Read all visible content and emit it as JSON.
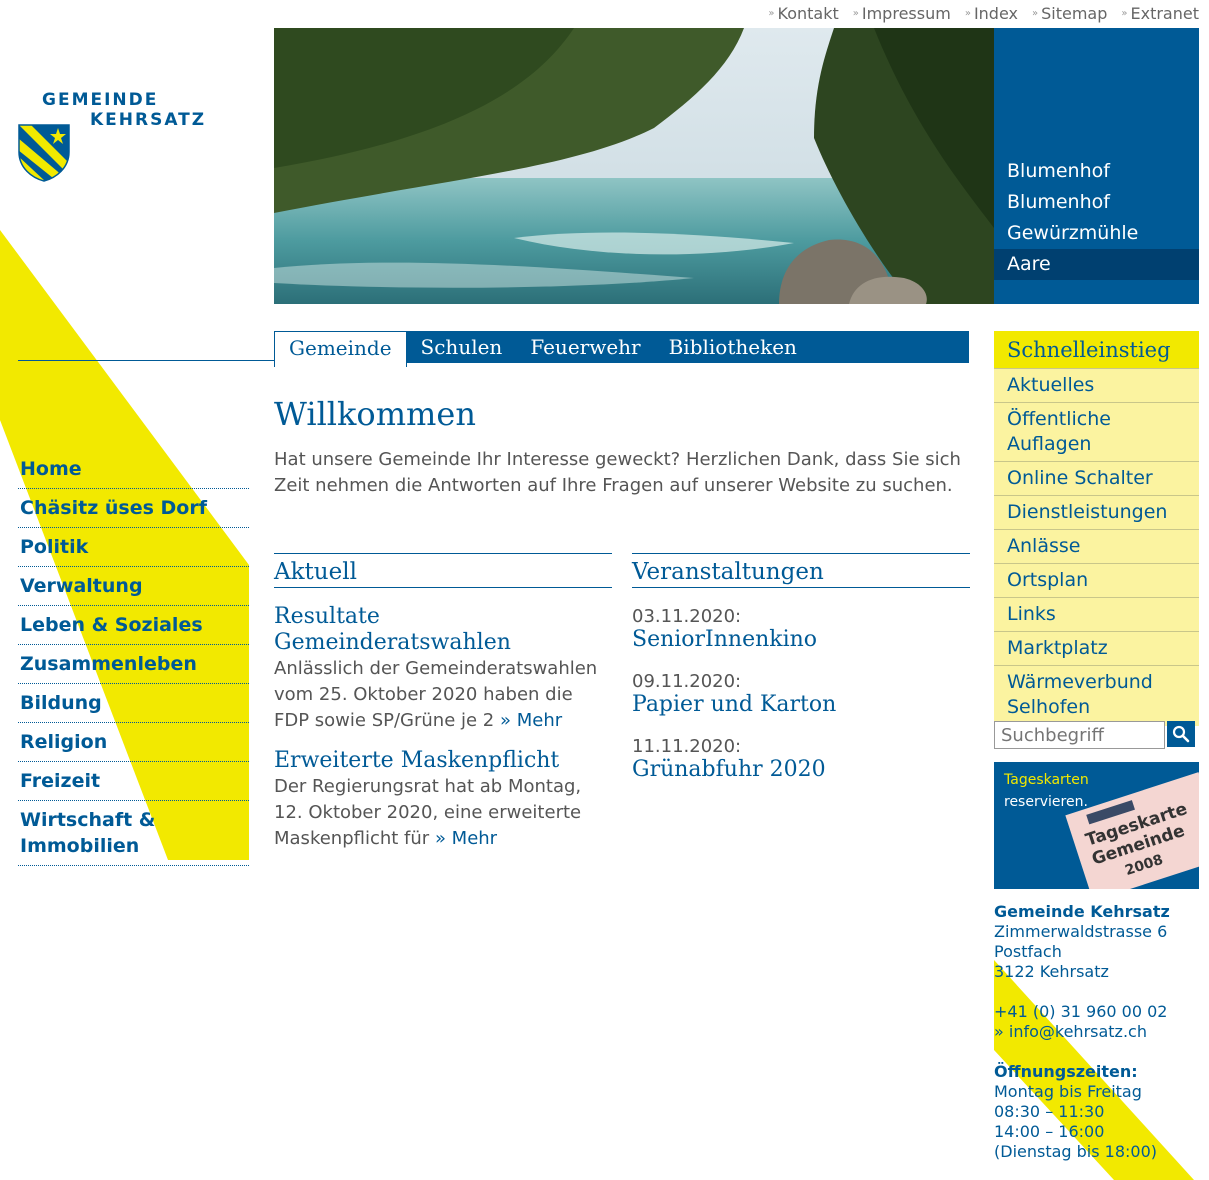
{
  "toplinks": [
    "Kontakt",
    "Impressum",
    "Index",
    "Sitemap",
    "Extranet"
  ],
  "logo": {
    "line1": "GEMEINDE",
    "line2": "KEHRSATZ"
  },
  "colors": {
    "brand_blue": "#005a96",
    "yellow": "#f2e900",
    "light_yellow": "#fbf3a0"
  },
  "hero_panel": {
    "items": [
      "Blumenhof",
      "Blumenhof",
      "Gewürzmühle",
      "Aare"
    ],
    "active": "Aare"
  },
  "leftnav": [
    "Home",
    "Chäsitz üses Dorf",
    "Politik",
    "Verwaltung",
    "Leben & Soziales",
    "Zusammenleben",
    "Bildung",
    "Religion",
    "Freizeit",
    "Wirtschaft & Immobilien"
  ],
  "tabs": {
    "items": [
      "Gemeinde",
      "Schulen",
      "Feuerwehr",
      "Bibliotheken"
    ],
    "active": "Gemeinde"
  },
  "welcome": {
    "title": "Willkommen",
    "text": "Hat unsere Gemeinde Ihr Interesse geweckt? Herzlichen Dank, dass Sie sich Zeit nehmen die Antworten auf Ihre Fragen auf unserer Website zu suchen."
  },
  "aktuell": {
    "heading": "Aktuell",
    "items": [
      {
        "title": "Resultate Gemeinderatswahlen",
        "text": "Anlässlich der Gemeinderatswahlen vom 25. Oktober 2020 haben die FDP sowie SP/Grüne je 2",
        "more": "» Mehr"
      },
      {
        "title": "Erweiterte Maskenpflicht",
        "text": "Der Regierungsrat hat ab Montag, 12. Oktober 2020, eine erweiterte Maskenpflicht für",
        "more": "» Mehr"
      }
    ]
  },
  "veranstaltungen": {
    "heading": "Veranstaltungen",
    "items": [
      {
        "date": "03.11.2020:",
        "title": "SeniorInnenkino"
      },
      {
        "date": "09.11.2020:",
        "title": "Papier und Karton"
      },
      {
        "date": "11.11.2020:",
        "title": "Grünabfuhr 2020"
      }
    ]
  },
  "quick": {
    "title": "Schnelleinstieg",
    "items": [
      "Aktuelles",
      "Öffentliche Auflagen",
      "Online Schalter",
      "Dienstleistungen",
      "Anlässe",
      "Ortsplan",
      "Links",
      "Marktplatz",
      "Wärmeverbund Selhofen"
    ]
  },
  "search": {
    "placeholder": "Suchbegriff"
  },
  "banner": {
    "line1": "Tageskarten",
    "line2": "reservieren.",
    "card_line1": "Tageskarte",
    "card_line2": "Gemeinde",
    "card_year": "2008"
  },
  "address": {
    "name": "Gemeinde Kehrsatz",
    "street": "Zimmerwaldstrasse 6",
    "pobox": "Postfach",
    "city": "3122 Kehrsatz",
    "phone": "+41 (0) 31 960 00 02",
    "email": "» info@kehrsatz.ch",
    "hours_label": "Öffnungszeiten:",
    "hours": [
      "Montag bis Freitag",
      "08:30 – 11:30",
      "14:00 – 16:00",
      "(Dienstag bis 18:00)"
    ]
  }
}
